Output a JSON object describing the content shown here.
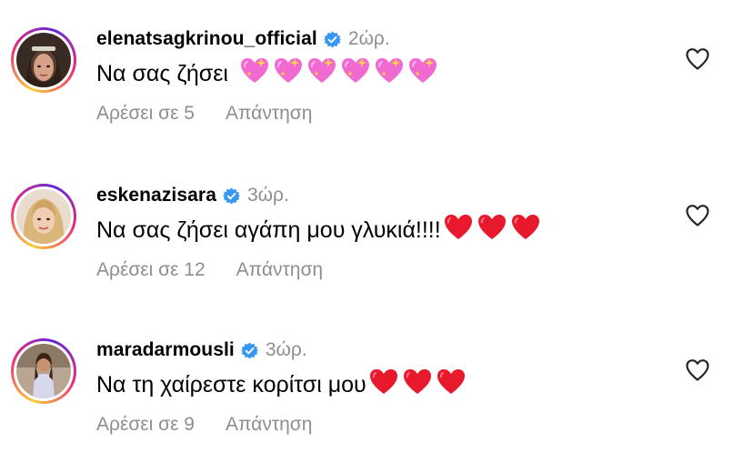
{
  "comments": [
    {
      "username": "elenatsagkrinou_official",
      "verified": true,
      "time": "2ώρ.",
      "text": "Να σας ζήσει",
      "emojis": [
        "sparkling-heart",
        "sparkling-heart",
        "sparkling-heart",
        "sparkling-heart",
        "sparkling-heart",
        "sparkling-heart"
      ],
      "likes_label": "Αρέσει σε 5",
      "reply_label": "Απάντηση"
    },
    {
      "username": "eskenazisara",
      "verified": true,
      "time": "3ώρ.",
      "text": "Να σας ζήσει αγάπη μου γλυκιά!!!!",
      "emojis": [
        "red-heart",
        "red-heart",
        "red-heart"
      ],
      "likes_label": "Αρέσει σε 12",
      "reply_label": "Απάντηση"
    },
    {
      "username": "maradarmousli",
      "verified": true,
      "time": "3ώρ.",
      "text": "Να τη χαίρεστε κορίτσι μου",
      "emojis": [
        "red-heart",
        "red-heart",
        "red-heart"
      ],
      "likes_label": "Αρέσει σε 9",
      "reply_label": "Απάντηση"
    }
  ],
  "colors": {
    "verified_blue": "#3897f0",
    "secondary_text": "#8e8e8e",
    "heart_red": "#e8192c",
    "sparkle_pink": "#f06ad2"
  }
}
